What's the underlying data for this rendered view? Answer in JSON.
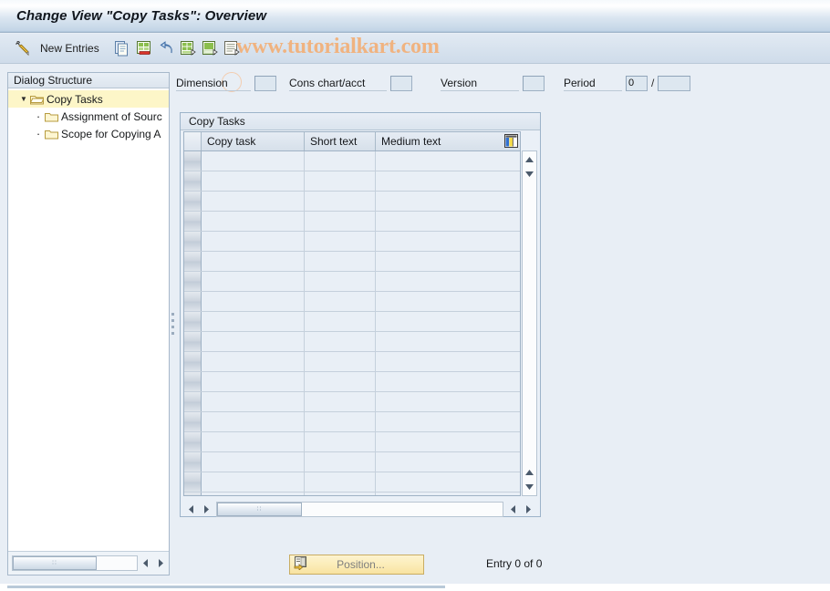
{
  "window": {
    "title": "Change View \"Copy Tasks\": Overview"
  },
  "toolbar": {
    "edit_icon": "pencil-icon",
    "new_entries_label": "New Entries",
    "buttons": [
      {
        "name": "copy-icon",
        "title": "Copy As..."
      },
      {
        "name": "delete-icon",
        "title": "Delete"
      },
      {
        "name": "undo-icon",
        "title": "Undo Change"
      },
      {
        "name": "select-all-icon",
        "title": "Select All"
      },
      {
        "name": "select-block-icon",
        "title": "Select Block"
      },
      {
        "name": "deselect-all-icon",
        "title": "Deselect All"
      }
    ],
    "watermark": "www.tutorialkart.com"
  },
  "sidebar": {
    "header": "Dialog Structure",
    "items": [
      {
        "label": "Copy Tasks",
        "expander": "▼",
        "icon": "open-folder-icon",
        "selected": true,
        "level": 0
      },
      {
        "label": "Assignment of Sourc",
        "expander": "·",
        "icon": "folder-icon",
        "selected": false,
        "level": 1
      },
      {
        "label": "Scope for Copying A",
        "expander": "·",
        "icon": "folder-icon",
        "selected": false,
        "level": 1
      }
    ],
    "scroll": {
      "left_arrow": "left-arrow-icon",
      "right_arrow": "right-arrow-icon",
      "grip": "∷"
    }
  },
  "form": {
    "fields": [
      {
        "label": "Dimension",
        "value": "",
        "name": "dimension"
      },
      {
        "label": "Cons chart/acct",
        "value": "",
        "name": "cons-chart-acct"
      },
      {
        "label": "Version",
        "value": "",
        "name": "version"
      },
      {
        "label": "Period",
        "value": "0",
        "name": "period-from"
      }
    ],
    "period_separator": "/",
    "period_to_value": ""
  },
  "table": {
    "panel_title": "Copy Tasks",
    "columns": [
      "Copy task",
      "Short text",
      "Medium text"
    ],
    "config_icon": "table-settings-icon",
    "rows": [],
    "empty_row_count": 17,
    "vscroll": {
      "up": "up-arrow-icon",
      "down": "down-arrow-icon"
    },
    "hscroll": {
      "left": "left-arrow-icon",
      "right": "right-arrow-icon",
      "grip": "∷"
    }
  },
  "footer": {
    "position_button": {
      "label": "Position...",
      "icon": "position-icon"
    },
    "entry_count": "Entry 0 of 0"
  },
  "colors": {
    "titlebar_accent": "#c3d5e6",
    "selection_yellow": "#fdf6c8",
    "watermark": "#f0b380",
    "panel_bg": "#e8eef5",
    "grid_cell": "#e9eff6"
  }
}
